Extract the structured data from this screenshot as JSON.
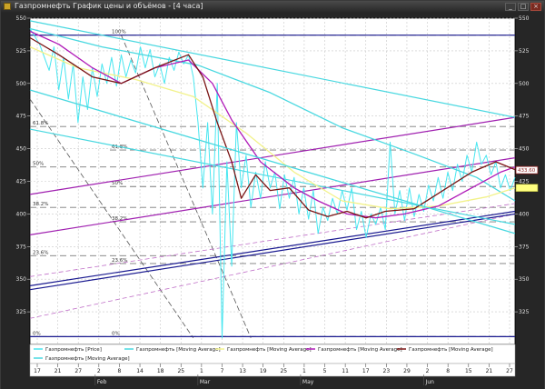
{
  "window": {
    "title": "Газпромнефть График цены и объёмов - [4 часа]",
    "minimize_glyph": "_",
    "maximize_glyph": "□",
    "close_glyph": "×"
  },
  "colors": {
    "background": "#ffffff",
    "grid": "#c8c8c8",
    "price": "#48e6f0",
    "ma_cyan": "#48d8e0",
    "ma_yellow": "#f2f28a",
    "ma_purple": "#b01ab8",
    "ma_darkred": "#7a1414",
    "trend_navy": "#1a1a90",
    "trend_magenta": "#a020b0",
    "fib": "#7a7a7a",
    "price_tag": "#8b1a1a",
    "yellow_tag": "#ffff80"
  },
  "chart_data": {
    "type": "line",
    "ylim": [
      300,
      550
    ],
    "y_ticks": [
      325,
      350,
      375,
      400,
      425,
      450,
      475,
      500,
      525,
      550
    ],
    "x_tick_labels": [
      "17",
      "21",
      "27",
      "2",
      "8",
      "14",
      "18",
      "25",
      "1",
      "7",
      "13",
      "19",
      "25",
      "1",
      "5",
      "11",
      "17",
      "23",
      "29",
      "2",
      "8",
      "15",
      "21",
      "27"
    ],
    "month_labels": [
      "Feb",
      "Mar",
      "May",
      "Jun"
    ],
    "last_price": "433.60",
    "series": [
      {
        "name": "Газпромнефть [Price]",
        "color": "#48e6f0",
        "values": [
          [
            0,
            542
          ],
          [
            2,
            530
          ],
          [
            4,
            510
          ],
          [
            5,
            528
          ],
          [
            6,
            495
          ],
          [
            7,
            520
          ],
          [
            8,
            488
          ],
          [
            9,
            515
          ],
          [
            10,
            470
          ],
          [
            11,
            505
          ],
          [
            12,
            480
          ],
          [
            13,
            512
          ],
          [
            14,
            490
          ],
          [
            15,
            515
          ],
          [
            16,
            500
          ],
          [
            17,
            520
          ],
          [
            18,
            498
          ],
          [
            19,
            522
          ],
          [
            20,
            505
          ],
          [
            21,
            518
          ],
          [
            22,
            508
          ],
          [
            23,
            528
          ],
          [
            24,
            512
          ],
          [
            25,
            526
          ],
          [
            26,
            505
          ],
          [
            27,
            515
          ],
          [
            28,
            500
          ],
          [
            29,
            520
          ],
          [
            30,
            510
          ],
          [
            31,
            524
          ],
          [
            32,
            515
          ],
          [
            33,
            522
          ],
          [
            34,
            505
          ],
          [
            35,
            470
          ],
          [
            36,
            420
          ],
          [
            37,
            470
          ],
          [
            38,
            400
          ],
          [
            39,
            500
          ],
          [
            40,
            305
          ],
          [
            41,
            440
          ],
          [
            42,
            360
          ],
          [
            43,
            470
          ],
          [
            44,
            420
          ],
          [
            45,
            445
          ],
          [
            46,
            405
          ],
          [
            47,
            432
          ],
          [
            48,
            412
          ],
          [
            49,
            440
          ],
          [
            50,
            420
          ],
          [
            51,
            432
          ],
          [
            52,
            404
          ],
          [
            53,
            430
          ],
          [
            54,
            412
          ],
          [
            55,
            428
          ],
          [
            56,
            400
          ],
          [
            57,
            420
          ],
          [
            58,
            396
          ],
          [
            59,
            418
          ],
          [
            60,
            385
          ],
          [
            61,
            405
          ],
          [
            62,
            395
          ],
          [
            63,
            412
          ],
          [
            64,
            400
          ],
          [
            65,
            418
          ],
          [
            66,
            403
          ],
          [
            67,
            420
          ],
          [
            68,
            388
          ],
          [
            69,
            402
          ],
          [
            70,
            382
          ],
          [
            71,
            400
          ],
          [
            72,
            392
          ],
          [
            73,
            405
          ],
          [
            74,
            388
          ],
          [
            75,
            455
          ],
          [
            76,
            400
          ],
          [
            77,
            418
          ],
          [
            78,
            395
          ],
          [
            79,
            420
          ],
          [
            80,
            398
          ],
          [
            81,
            415
          ],
          [
            82,
            402
          ],
          [
            83,
            422
          ],
          [
            84,
            410
          ],
          [
            85,
            428
          ],
          [
            86,
            412
          ],
          [
            87,
            432
          ],
          [
            88,
            418
          ],
          [
            89,
            438
          ],
          [
            90,
            425
          ],
          [
            91,
            445
          ],
          [
            92,
            432
          ],
          [
            93,
            455
          ],
          [
            94,
            438
          ],
          [
            95,
            445
          ],
          [
            96,
            430
          ],
          [
            97,
            440
          ],
          [
            98,
            420
          ],
          [
            99,
            430
          ],
          [
            100,
            418
          ],
          [
            101,
            428
          ]
        ]
      },
      {
        "name": "Газпромнефть [Moving Average]",
        "color": "#48d8e0",
        "values": [
          [
            0,
            542
          ],
          [
            15,
            528
          ],
          [
            35,
            514
          ],
          [
            50,
            493
          ],
          [
            65,
            466
          ],
          [
            80,
            446
          ],
          [
            93,
            428
          ],
          [
            101,
            410
          ]
        ]
      },
      {
        "name": "Газпромнефть [Moving Average]",
        "color": "#f2f28a",
        "values": [
          [
            0,
            528
          ],
          [
            10,
            512
          ],
          [
            22,
            503
          ],
          [
            34,
            490
          ],
          [
            45,
            462
          ],
          [
            55,
            432
          ],
          [
            65,
            410
          ],
          [
            75,
            404
          ],
          [
            85,
            406
          ],
          [
            95,
            413
          ],
          [
            101,
            420
          ]
        ]
      },
      {
        "name": "Газпромнефть [Moving Average]",
        "color": "#b01ab8",
        "values": [
          [
            0,
            540
          ],
          [
            6,
            530
          ],
          [
            13,
            512
          ],
          [
            19,
            500
          ],
          [
            26,
            512
          ],
          [
            33,
            518
          ],
          [
            38,
            500
          ],
          [
            42,
            472
          ],
          [
            48,
            440
          ],
          [
            55,
            420
          ],
          [
            60,
            410
          ],
          [
            66,
            400
          ],
          [
            72,
            397
          ],
          [
            78,
            400
          ],
          [
            85,
            406
          ],
          [
            92,
            420
          ],
          [
            98,
            432
          ],
          [
            101,
            436
          ]
        ]
      },
      {
        "name": "Газпромнефть [Moving Average]",
        "color": "#7a1414",
        "values": [
          [
            0,
            535
          ],
          [
            6,
            522
          ],
          [
            13,
            505
          ],
          [
            19,
            500
          ],
          [
            26,
            512
          ],
          [
            33,
            522
          ],
          [
            36,
            505
          ],
          [
            39,
            470
          ],
          [
            42,
            440
          ],
          [
            44,
            412
          ],
          [
            47,
            430
          ],
          [
            50,
            418
          ],
          [
            54,
            420
          ],
          [
            58,
            403
          ],
          [
            62,
            398
          ],
          [
            66,
            402
          ],
          [
            70,
            397
          ],
          [
            74,
            402
          ],
          [
            80,
            404
          ],
          [
            86,
            418
          ],
          [
            92,
            432
          ],
          [
            97,
            440
          ],
          [
            101,
            434
          ]
        ]
      },
      {
        "name": "Газпромнефть [Moving Average]",
        "color": "#48d8e0",
        "values": [
          [
            0,
            495
          ],
          [
            101,
            385
          ]
        ]
      }
    ],
    "fib_levels_left": [
      {
        "label": "100%",
        "value": 537
      },
      {
        "label": "61.8%",
        "value": 467
      },
      {
        "label": "50%",
        "value": 436
      },
      {
        "label": "38.2%",
        "value": 405
      },
      {
        "label": "23.6%",
        "value": 368
      },
      {
        "label": "0%",
        "value": 306
      }
    ],
    "fib_levels_right": [
      {
        "label": "61.8%",
        "value": 449
      },
      {
        "label": "50%",
        "value": 421
      },
      {
        "label": "38.2%",
        "value": 394
      },
      {
        "label": "23.6%",
        "value": 362
      },
      {
        "label": "0%",
        "value": 306
      }
    ],
    "trend_lines": [
      {
        "color": "#1a1a90",
        "from": [
          0,
          537
        ],
        "to": [
          101,
          537
        ]
      },
      {
        "color": "#1a1a90",
        "from": [
          0,
          306
        ],
        "to": [
          101,
          306
        ]
      },
      {
        "color": "#1a1a90",
        "from": [
          0,
          342
        ],
        "to": [
          101,
          400
        ]
      },
      {
        "color": "#1a1a90",
        "from": [
          0,
          345
        ],
        "to": [
          101,
          402
        ]
      },
      {
        "color": "#a020b0",
        "from": [
          0,
          415
        ],
        "to": [
          101,
          474
        ]
      },
      {
        "color": "#a020b0",
        "from": [
          0,
          384
        ],
        "to": [
          101,
          443
        ]
      },
      {
        "color": "#48d8e0",
        "from": [
          0,
          548
        ],
        "to": [
          101,
          474
        ]
      },
      {
        "color": "#48d8e0",
        "from": [
          0,
          465
        ],
        "to": [
          101,
          392
        ]
      }
    ]
  }
}
